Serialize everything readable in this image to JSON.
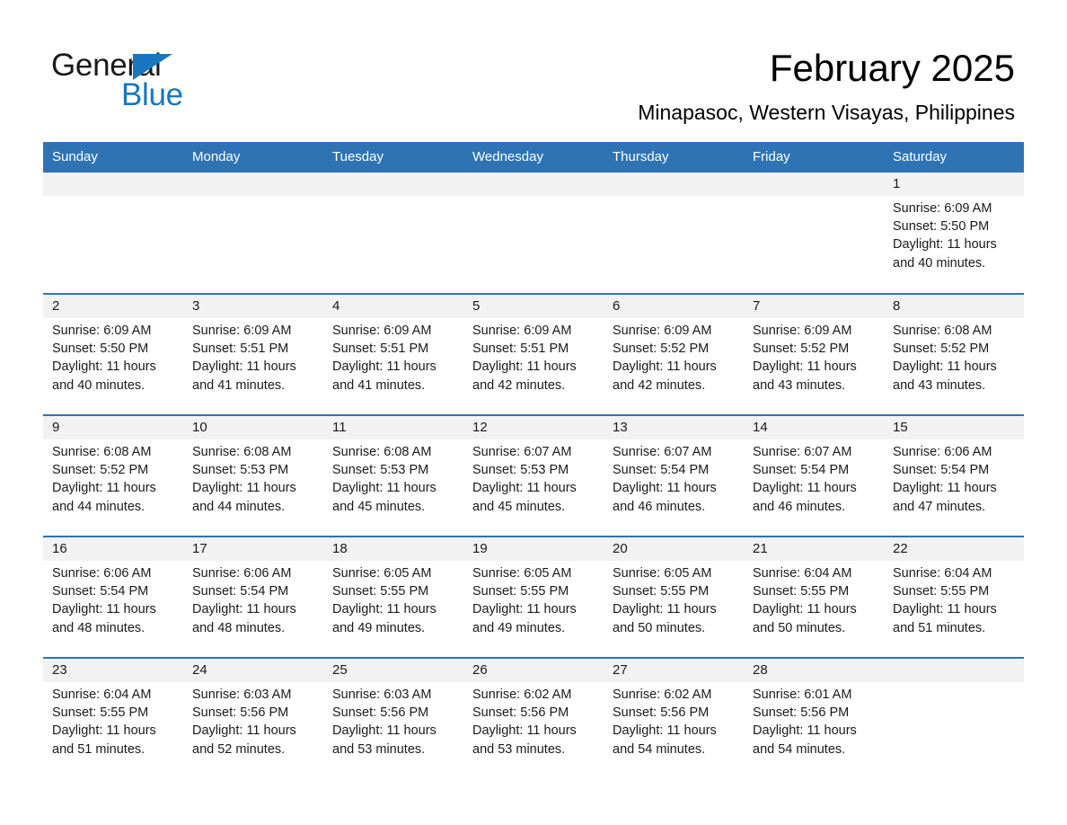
{
  "logo": {
    "word1": "General",
    "word2": "Blue",
    "triangle_color": "#1877c0",
    "text_color": "#1a1a1a"
  },
  "header": {
    "month_title": "February 2025",
    "location": "Minapasoc, Western Visayas, Philippines"
  },
  "theme": {
    "header_blue": "#2e74b5",
    "daynum_band": "#f2f2f2",
    "text": "#1a1a1a"
  },
  "calendar": {
    "weekday_headers": [
      "Sunday",
      "Monday",
      "Tuesday",
      "Wednesday",
      "Thursday",
      "Friday",
      "Saturday"
    ],
    "weeks": [
      [
        {
          "day": "",
          "sunrise": "",
          "sunset": "",
          "daylight1": "",
          "daylight2": "",
          "empty": true
        },
        {
          "day": "",
          "sunrise": "",
          "sunset": "",
          "daylight1": "",
          "daylight2": "",
          "empty": true
        },
        {
          "day": "",
          "sunrise": "",
          "sunset": "",
          "daylight1": "",
          "daylight2": "",
          "empty": true
        },
        {
          "day": "",
          "sunrise": "",
          "sunset": "",
          "daylight1": "",
          "daylight2": "",
          "empty": true
        },
        {
          "day": "",
          "sunrise": "",
          "sunset": "",
          "daylight1": "",
          "daylight2": "",
          "empty": true
        },
        {
          "day": "",
          "sunrise": "",
          "sunset": "",
          "daylight1": "",
          "daylight2": "",
          "empty": true
        },
        {
          "day": "1",
          "sunrise": "Sunrise: 6:09 AM",
          "sunset": "Sunset: 5:50 PM",
          "daylight1": "Daylight: 11 hours",
          "daylight2": "and 40 minutes.",
          "empty": false
        }
      ],
      [
        {
          "day": "2",
          "sunrise": "Sunrise: 6:09 AM",
          "sunset": "Sunset: 5:50 PM",
          "daylight1": "Daylight: 11 hours",
          "daylight2": "and 40 minutes.",
          "empty": false
        },
        {
          "day": "3",
          "sunrise": "Sunrise: 6:09 AM",
          "sunset": "Sunset: 5:51 PM",
          "daylight1": "Daylight: 11 hours",
          "daylight2": "and 41 minutes.",
          "empty": false
        },
        {
          "day": "4",
          "sunrise": "Sunrise: 6:09 AM",
          "sunset": "Sunset: 5:51 PM",
          "daylight1": "Daylight: 11 hours",
          "daylight2": "and 41 minutes.",
          "empty": false
        },
        {
          "day": "5",
          "sunrise": "Sunrise: 6:09 AM",
          "sunset": "Sunset: 5:51 PM",
          "daylight1": "Daylight: 11 hours",
          "daylight2": "and 42 minutes.",
          "empty": false
        },
        {
          "day": "6",
          "sunrise": "Sunrise: 6:09 AM",
          "sunset": "Sunset: 5:52 PM",
          "daylight1": "Daylight: 11 hours",
          "daylight2": "and 42 minutes.",
          "empty": false
        },
        {
          "day": "7",
          "sunrise": "Sunrise: 6:09 AM",
          "sunset": "Sunset: 5:52 PM",
          "daylight1": "Daylight: 11 hours",
          "daylight2": "and 43 minutes.",
          "empty": false
        },
        {
          "day": "8",
          "sunrise": "Sunrise: 6:08 AM",
          "sunset": "Sunset: 5:52 PM",
          "daylight1": "Daylight: 11 hours",
          "daylight2": "and 43 minutes.",
          "empty": false
        }
      ],
      [
        {
          "day": "9",
          "sunrise": "Sunrise: 6:08 AM",
          "sunset": "Sunset: 5:52 PM",
          "daylight1": "Daylight: 11 hours",
          "daylight2": "and 44 minutes.",
          "empty": false
        },
        {
          "day": "10",
          "sunrise": "Sunrise: 6:08 AM",
          "sunset": "Sunset: 5:53 PM",
          "daylight1": "Daylight: 11 hours",
          "daylight2": "and 44 minutes.",
          "empty": false
        },
        {
          "day": "11",
          "sunrise": "Sunrise: 6:08 AM",
          "sunset": "Sunset: 5:53 PM",
          "daylight1": "Daylight: 11 hours",
          "daylight2": "and 45 minutes.",
          "empty": false
        },
        {
          "day": "12",
          "sunrise": "Sunrise: 6:07 AM",
          "sunset": "Sunset: 5:53 PM",
          "daylight1": "Daylight: 11 hours",
          "daylight2": "and 45 minutes.",
          "empty": false
        },
        {
          "day": "13",
          "sunrise": "Sunrise: 6:07 AM",
          "sunset": "Sunset: 5:54 PM",
          "daylight1": "Daylight: 11 hours",
          "daylight2": "and 46 minutes.",
          "empty": false
        },
        {
          "day": "14",
          "sunrise": "Sunrise: 6:07 AM",
          "sunset": "Sunset: 5:54 PM",
          "daylight1": "Daylight: 11 hours",
          "daylight2": "and 46 minutes.",
          "empty": false
        },
        {
          "day": "15",
          "sunrise": "Sunrise: 6:06 AM",
          "sunset": "Sunset: 5:54 PM",
          "daylight1": "Daylight: 11 hours",
          "daylight2": "and 47 minutes.",
          "empty": false
        }
      ],
      [
        {
          "day": "16",
          "sunrise": "Sunrise: 6:06 AM",
          "sunset": "Sunset: 5:54 PM",
          "daylight1": "Daylight: 11 hours",
          "daylight2": "and 48 minutes.",
          "empty": false
        },
        {
          "day": "17",
          "sunrise": "Sunrise: 6:06 AM",
          "sunset": "Sunset: 5:54 PM",
          "daylight1": "Daylight: 11 hours",
          "daylight2": "and 48 minutes.",
          "empty": false
        },
        {
          "day": "18",
          "sunrise": "Sunrise: 6:05 AM",
          "sunset": "Sunset: 5:55 PM",
          "daylight1": "Daylight: 11 hours",
          "daylight2": "and 49 minutes.",
          "empty": false
        },
        {
          "day": "19",
          "sunrise": "Sunrise: 6:05 AM",
          "sunset": "Sunset: 5:55 PM",
          "daylight1": "Daylight: 11 hours",
          "daylight2": "and 49 minutes.",
          "empty": false
        },
        {
          "day": "20",
          "sunrise": "Sunrise: 6:05 AM",
          "sunset": "Sunset: 5:55 PM",
          "daylight1": "Daylight: 11 hours",
          "daylight2": "and 50 minutes.",
          "empty": false
        },
        {
          "day": "21",
          "sunrise": "Sunrise: 6:04 AM",
          "sunset": "Sunset: 5:55 PM",
          "daylight1": "Daylight: 11 hours",
          "daylight2": "and 50 minutes.",
          "empty": false
        },
        {
          "day": "22",
          "sunrise": "Sunrise: 6:04 AM",
          "sunset": "Sunset: 5:55 PM",
          "daylight1": "Daylight: 11 hours",
          "daylight2": "and 51 minutes.",
          "empty": false
        }
      ],
      [
        {
          "day": "23",
          "sunrise": "Sunrise: 6:04 AM",
          "sunset": "Sunset: 5:55 PM",
          "daylight1": "Daylight: 11 hours",
          "daylight2": "and 51 minutes.",
          "empty": false
        },
        {
          "day": "24",
          "sunrise": "Sunrise: 6:03 AM",
          "sunset": "Sunset: 5:56 PM",
          "daylight1": "Daylight: 11 hours",
          "daylight2": "and 52 minutes.",
          "empty": false
        },
        {
          "day": "25",
          "sunrise": "Sunrise: 6:03 AM",
          "sunset": "Sunset: 5:56 PM",
          "daylight1": "Daylight: 11 hours",
          "daylight2": "and 53 minutes.",
          "empty": false
        },
        {
          "day": "26",
          "sunrise": "Sunrise: 6:02 AM",
          "sunset": "Sunset: 5:56 PM",
          "daylight1": "Daylight: 11 hours",
          "daylight2": "and 53 minutes.",
          "empty": false
        },
        {
          "day": "27",
          "sunrise": "Sunrise: 6:02 AM",
          "sunset": "Sunset: 5:56 PM",
          "daylight1": "Daylight: 11 hours",
          "daylight2": "and 54 minutes.",
          "empty": false
        },
        {
          "day": "28",
          "sunrise": "Sunrise: 6:01 AM",
          "sunset": "Sunset: 5:56 PM",
          "daylight1": "Daylight: 11 hours",
          "daylight2": "and 54 minutes.",
          "empty": false
        },
        {
          "day": "",
          "sunrise": "",
          "sunset": "",
          "daylight1": "",
          "daylight2": "",
          "empty": true
        }
      ]
    ]
  }
}
